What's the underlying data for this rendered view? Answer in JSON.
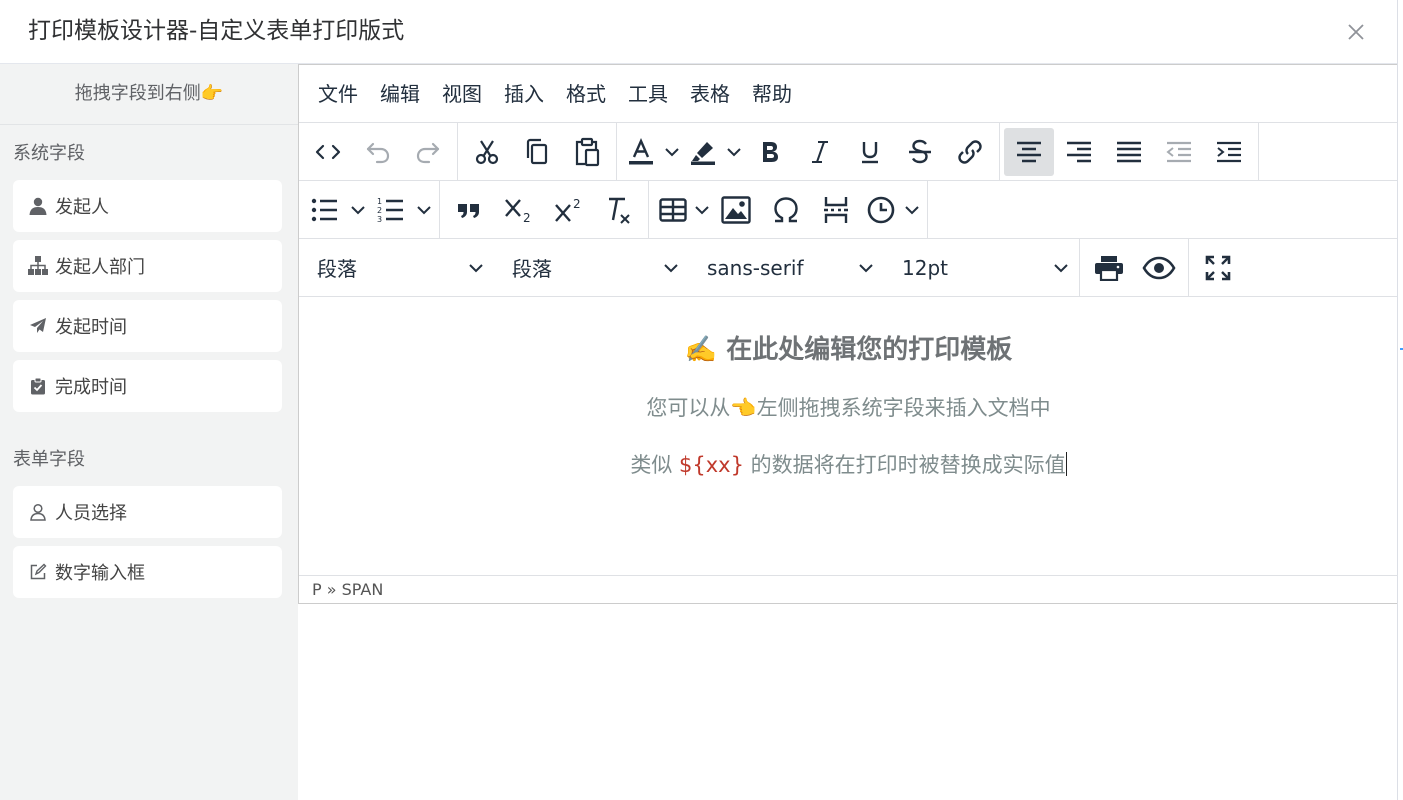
{
  "dialog": {
    "title": "打印模板设计器-自定义表单打印版式"
  },
  "sidebar": {
    "drag_tip": "拖拽字段到右侧",
    "drag_tip_emoji": "👉",
    "system_group": "系统字段",
    "system_fields": [
      {
        "label": "发起人",
        "icon": "user-solid-icon"
      },
      {
        "label": "发起人部门",
        "icon": "org-chart-icon"
      },
      {
        "label": "发起时间",
        "icon": "paper-plane-icon"
      },
      {
        "label": "完成时间",
        "icon": "clipboard-check-icon"
      }
    ],
    "form_group": "表单字段",
    "form_fields": [
      {
        "label": "人员选择",
        "icon": "user-outline-icon"
      },
      {
        "label": "数字输入框",
        "icon": "edit-icon"
      }
    ]
  },
  "editor": {
    "menu": [
      "文件",
      "编辑",
      "视图",
      "插入",
      "格式",
      "工具",
      "表格",
      "帮助"
    ],
    "selects": {
      "block": "段落",
      "block2": "段落",
      "font": "sans-serif",
      "size": "12pt"
    },
    "content": {
      "heading_emoji": "✍️",
      "heading": "在此处编辑您的打印模板",
      "line1_pre": "您可以从",
      "line1_emoji": "👈",
      "line1_post": "左侧拖拽系统字段来插入文档中",
      "line2_pre": "类似 ",
      "line2_var": "${xx}",
      "line2_post": " 的数据将在打印时被替换成实际值"
    },
    "statusbar": "P » SPAN"
  },
  "colors": {
    "accent": "#409eff",
    "text": "#222f3e",
    "variable": "#c0392b",
    "muted": "#7f8c8d"
  }
}
